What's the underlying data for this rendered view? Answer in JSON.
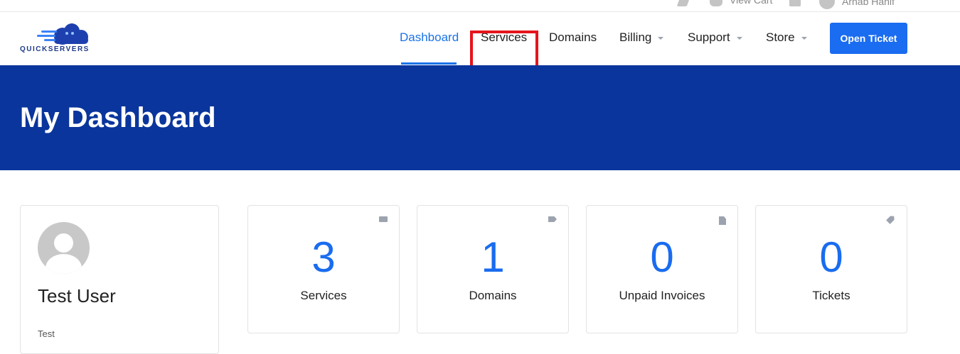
{
  "topbar": {
    "items": [
      {
        "label": "",
        "icon": "share-icon"
      },
      {
        "label": "View Cart",
        "icon": "cart-icon"
      },
      {
        "label": "",
        "icon": "bell-icon"
      },
      {
        "label": "Arnab Hanif",
        "icon": "user-avatar-icon"
      }
    ]
  },
  "brand": {
    "name": "QUICKSERVERS",
    "accent": "#1e3a8a"
  },
  "nav": {
    "items": [
      {
        "label": "Dashboard",
        "active": true,
        "dropdown": false
      },
      {
        "label": "Services",
        "active": false,
        "dropdown": false
      },
      {
        "label": "Domains",
        "active": false,
        "dropdown": false
      },
      {
        "label": "Billing",
        "active": false,
        "dropdown": true
      },
      {
        "label": "Support",
        "active": false,
        "dropdown": true
      },
      {
        "label": "Store",
        "active": false,
        "dropdown": true
      }
    ],
    "cta_label": "Open Ticket"
  },
  "hero": {
    "title": "My Dashboard",
    "color": "#0a359c"
  },
  "profile": {
    "name": "Test User",
    "company": "Test"
  },
  "stats": [
    {
      "value": "3",
      "label": "Services",
      "icon": "server-icon"
    },
    {
      "value": "1",
      "label": "Domains",
      "icon": "tag-icon"
    },
    {
      "value": "0",
      "label": "Unpaid Invoices",
      "icon": "file-icon"
    },
    {
      "value": "0",
      "label": "Tickets",
      "icon": "ticket-icon"
    }
  ],
  "colors": {
    "primary": "#1a6cf0",
    "highlight": "#e5141b"
  }
}
